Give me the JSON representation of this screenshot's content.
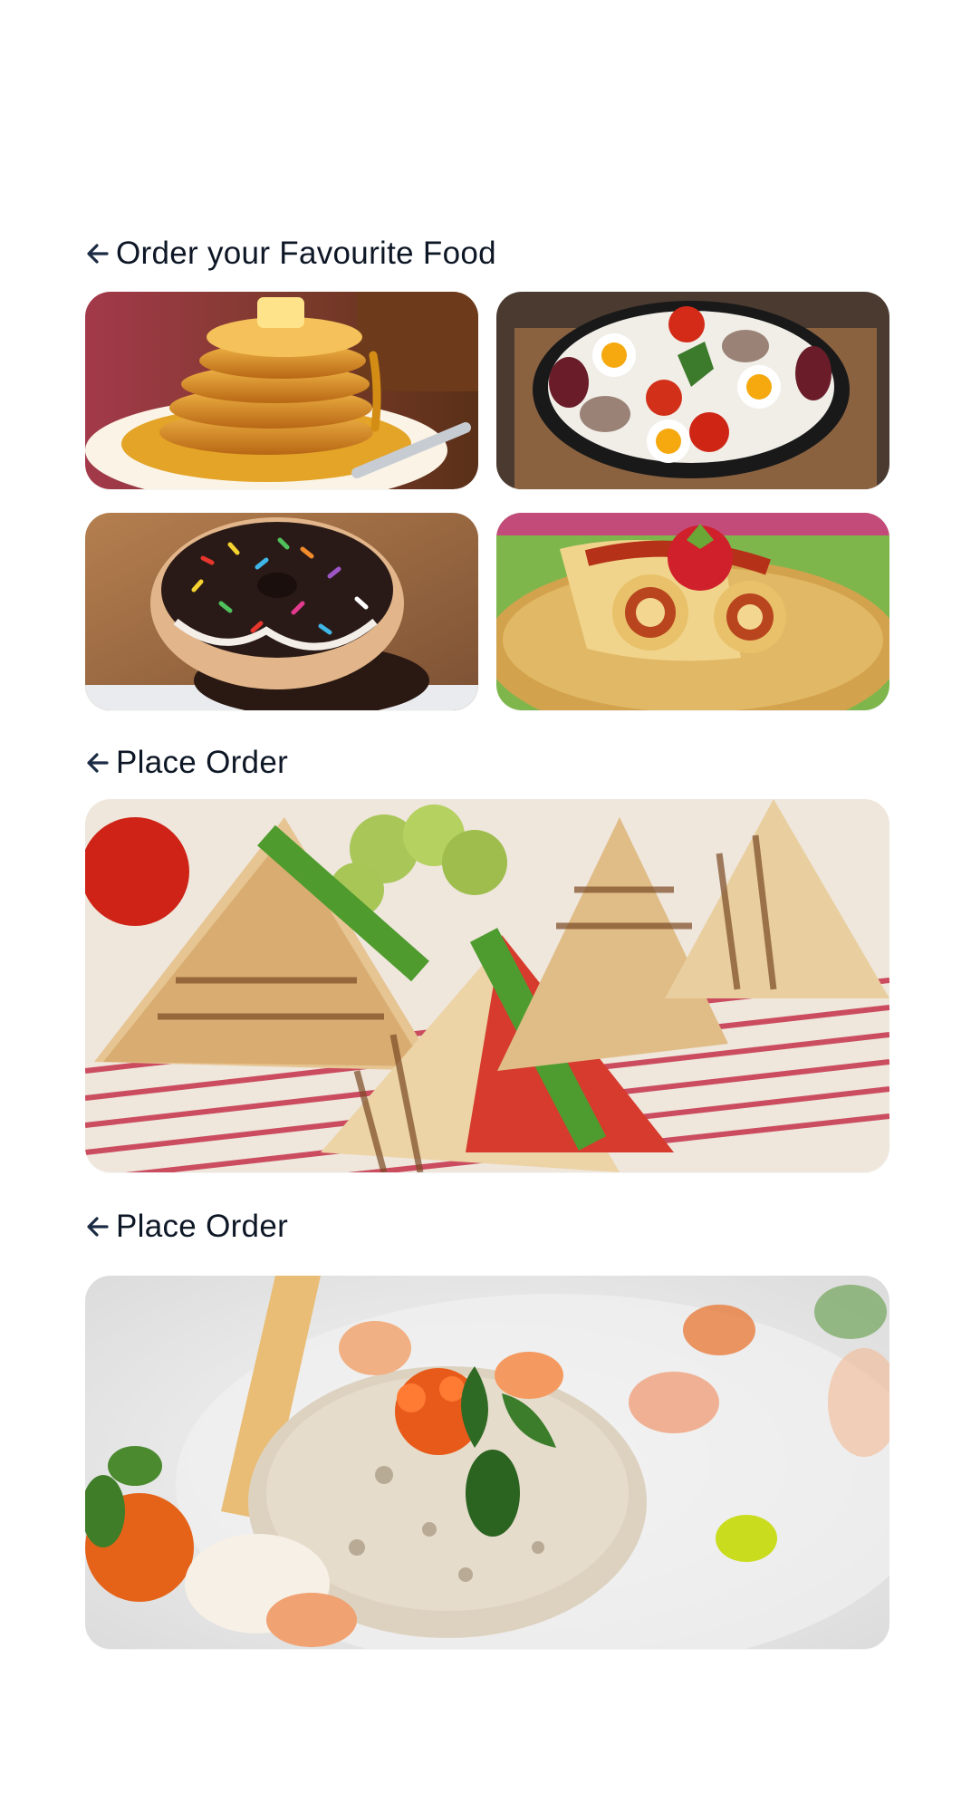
{
  "sections": [
    {
      "title": "Order your Favourite Food",
      "back_icon": "arrow-left-icon"
    },
    {
      "title": "Place Order",
      "back_icon": "arrow-left-icon"
    },
    {
      "title": "Place Order",
      "back_icon": "arrow-left-icon"
    }
  ],
  "tiles": [
    {
      "name": "pancakes-with-syrup"
    },
    {
      "name": "fried-eggs-sausage-skillet"
    },
    {
      "name": "sprinkle-donut"
    },
    {
      "name": "crepe-rolls-strawberry"
    },
    {
      "name": "grilled-club-sandwich"
    },
    {
      "name": "seafood-salad-tartare"
    }
  ],
  "colors": {
    "title": "#0e1726",
    "icon": "#1c2b44",
    "background": "#ffffff"
  }
}
